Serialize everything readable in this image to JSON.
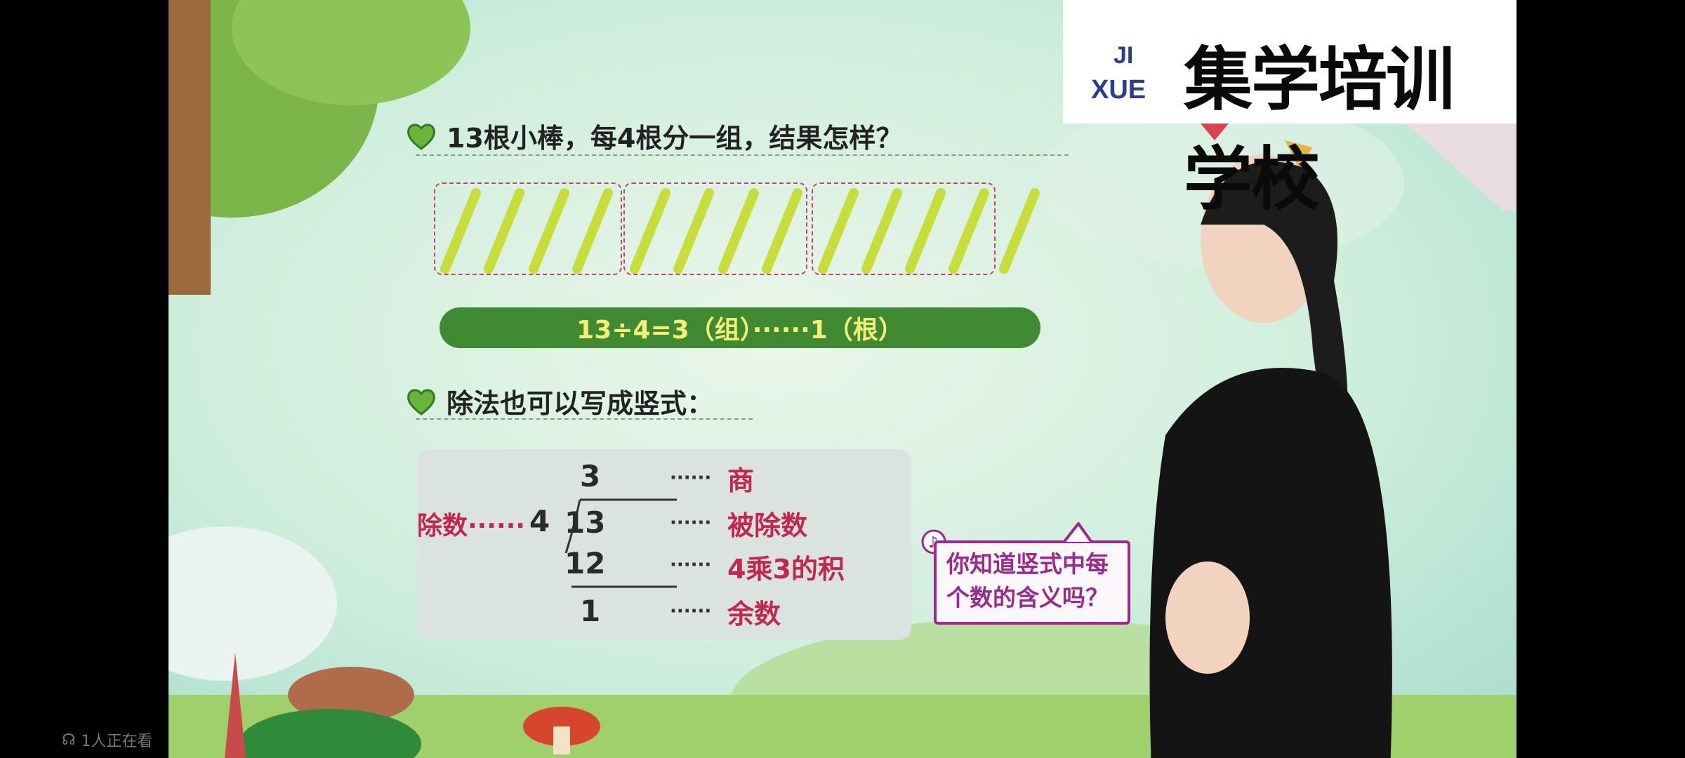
{
  "brand": {
    "logo_mark_top": "JI",
    "logo_mark_bottom": "XUE",
    "name": "集学培训学校"
  },
  "lesson": {
    "question": "13根小棒，每4根分一组，结果怎样？",
    "equation": "13÷4=3（组）······1（根）",
    "vertical_intro": "除法也可以写成竖式：",
    "vertical": {
      "quotient": "3",
      "divisor_label": "除数······",
      "divisor": "4",
      "dividend": "13",
      "product": "12",
      "remainder": "1",
      "dots": "······",
      "quotient_label": "商",
      "dividend_label": "被除数",
      "product_label": "4乘3的积",
      "remainder_label": "余数"
    },
    "hint_bubble": "你知道竖式中每个数的含义吗？"
  },
  "overlay": {
    "viewer_count": "1人正在看"
  },
  "colors": {
    "stick": "#c9dd3a",
    "group_border": "#c2466a",
    "equation_bg": "#3f8a33",
    "equation_text": "#f4ef75",
    "label_red": "#c2284f",
    "bubble": "#9a2a8c"
  }
}
